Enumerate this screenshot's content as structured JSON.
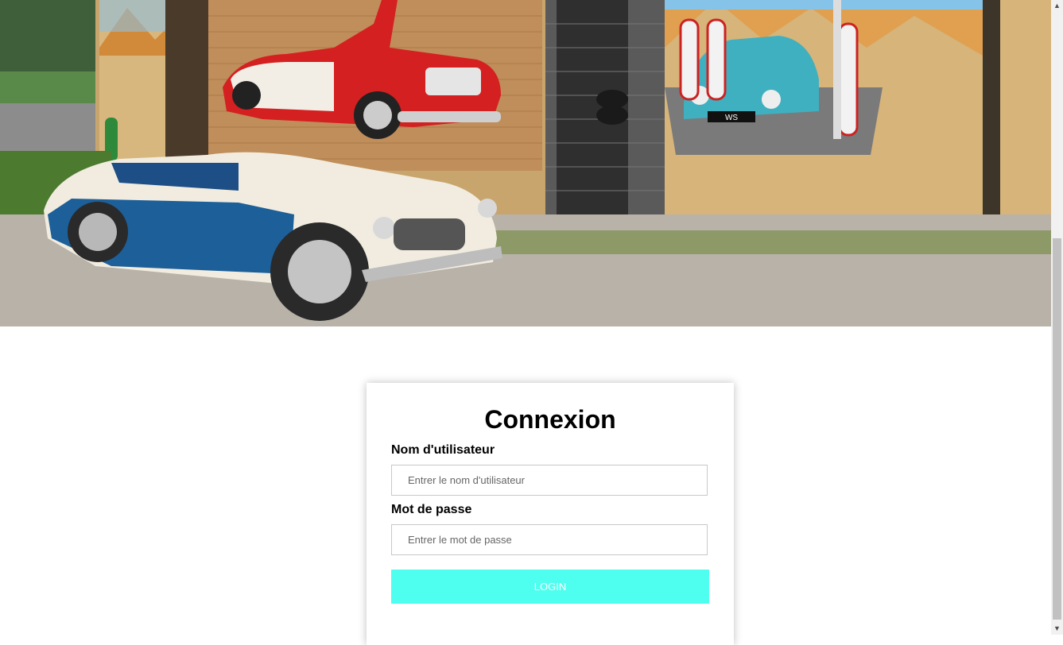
{
  "hero": {
    "mural_plate": "WS"
  },
  "login": {
    "title": "Connexion",
    "username_label": "Nom d'utilisateur",
    "username_placeholder": "Entrer le nom d'utilisateur",
    "username_value": "",
    "password_label": "Mot de passe",
    "password_placeholder": "Entrer le mot de passe",
    "password_value": "",
    "button_label": "LOGIN"
  },
  "colors": {
    "button_bg": "#4effef",
    "button_text": "#ffffff"
  }
}
